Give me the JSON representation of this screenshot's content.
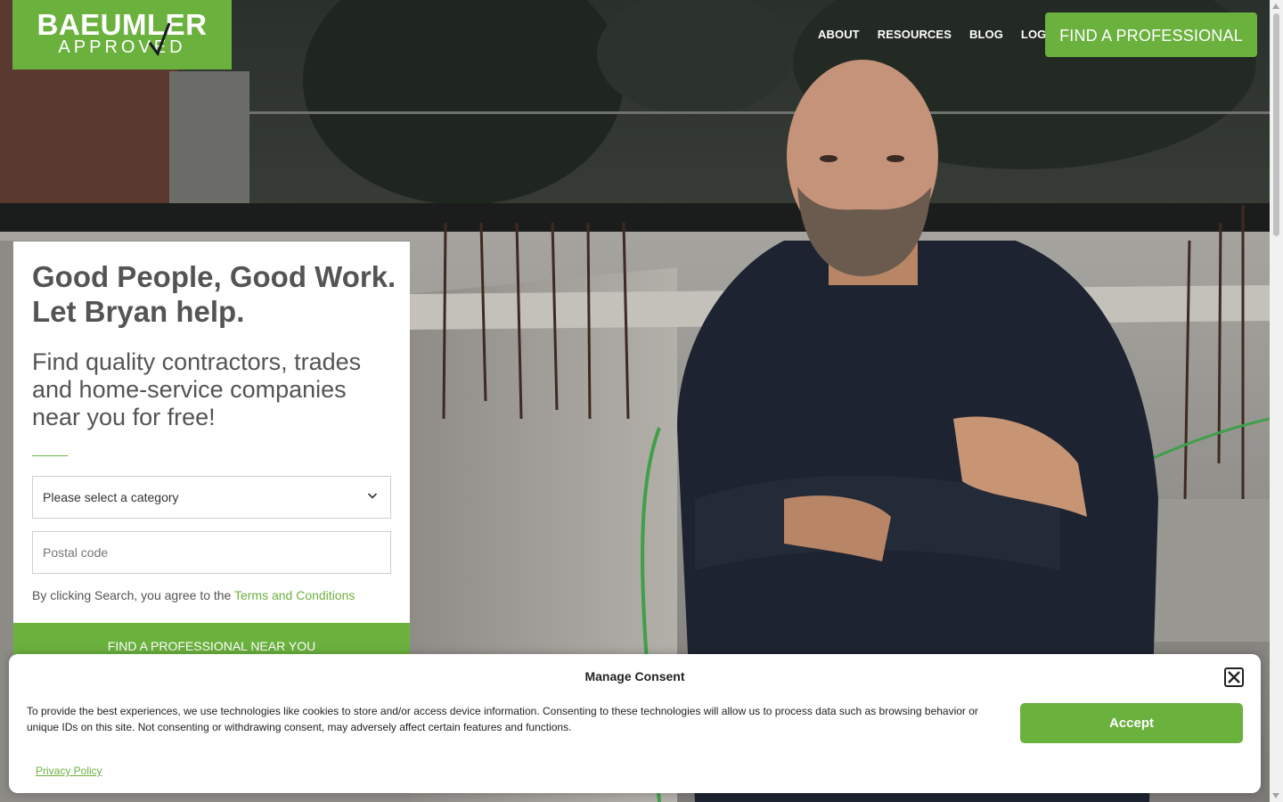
{
  "brand": {
    "line1": "BAEUMLER",
    "line2": "APPROVED",
    "color": "#6bb13e"
  },
  "nav": {
    "links": [
      "ABOUT",
      "RESOURCES",
      "BLOG",
      "LOGIN"
    ],
    "cta": "FIND A PROFESSIONAL"
  },
  "search_card": {
    "headline": "Good People, Good Work. Let Bryan help.",
    "subheadline": "Find quality contractors, trades and home-service companies near you for free!",
    "category_select": "Please select a category",
    "postal_placeholder": "Postal code",
    "terms_prefix": "By clicking Search, you agree to the ",
    "terms_link": "Terms and Conditions",
    "cta": "FIND A PROFESSIONAL NEAR YOU"
  },
  "consent": {
    "title": "Manage Consent",
    "body": "To provide the best experiences, we use technologies like cookies to store and/or access device information. Consenting to these technologies will allow us to process data such as browsing behavior or unique IDs on this site. Not consenting or withdrawing consent, may adversely affect certain features and functions.",
    "accept": "Accept",
    "privacy_link": "Privacy Policy"
  },
  "icons": {
    "select": "chevron-down-icon",
    "close": "close-icon",
    "logo_mark": "checkmark-icon"
  }
}
